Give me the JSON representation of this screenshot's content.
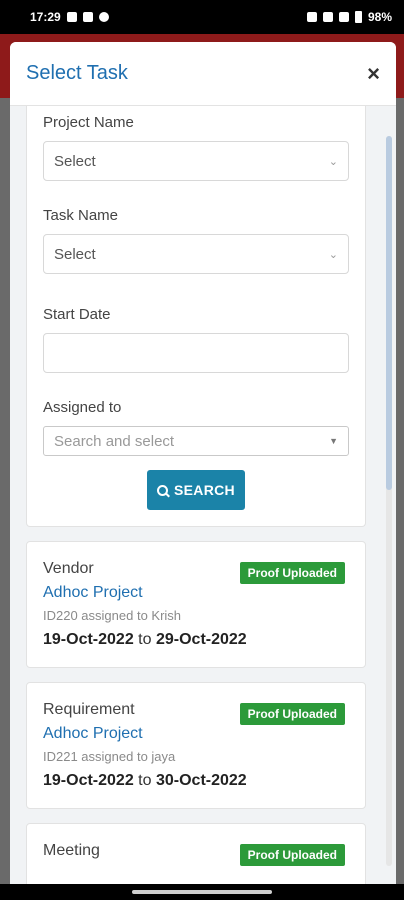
{
  "status_bar": {
    "time": "17:29",
    "battery": "98%"
  },
  "modal": {
    "title": "Select Task",
    "close": "×"
  },
  "form": {
    "project_label": "Project Name",
    "project_value": "Select",
    "task_label": "Task Name",
    "task_value": "Select",
    "start_date_label": "Start Date",
    "start_date_value": "",
    "assigned_label": "Assigned to",
    "assigned_placeholder": "Search and select",
    "search_button": "SEARCH"
  },
  "tasks": [
    {
      "type": "Vendor",
      "status": "Proof Uploaded",
      "project": "Adhoc Project",
      "assigned": "ID220 assigned to Krish",
      "start": "19-Oct-2022",
      "to": "to",
      "end": "29-Oct-2022"
    },
    {
      "type": "Requirement",
      "status": "Proof Uploaded",
      "project": "Adhoc Project",
      "assigned": "ID221 assigned to jaya",
      "start": "19-Oct-2022",
      "to": "to",
      "end": "30-Oct-2022"
    },
    {
      "type": "Meeting",
      "status": "Proof Uploaded"
    }
  ],
  "colors": {
    "accent": "#1f6fb0",
    "badge": "#2c9a3a",
    "button": "#1b83a8",
    "header_bg": "#8e1a1a"
  }
}
